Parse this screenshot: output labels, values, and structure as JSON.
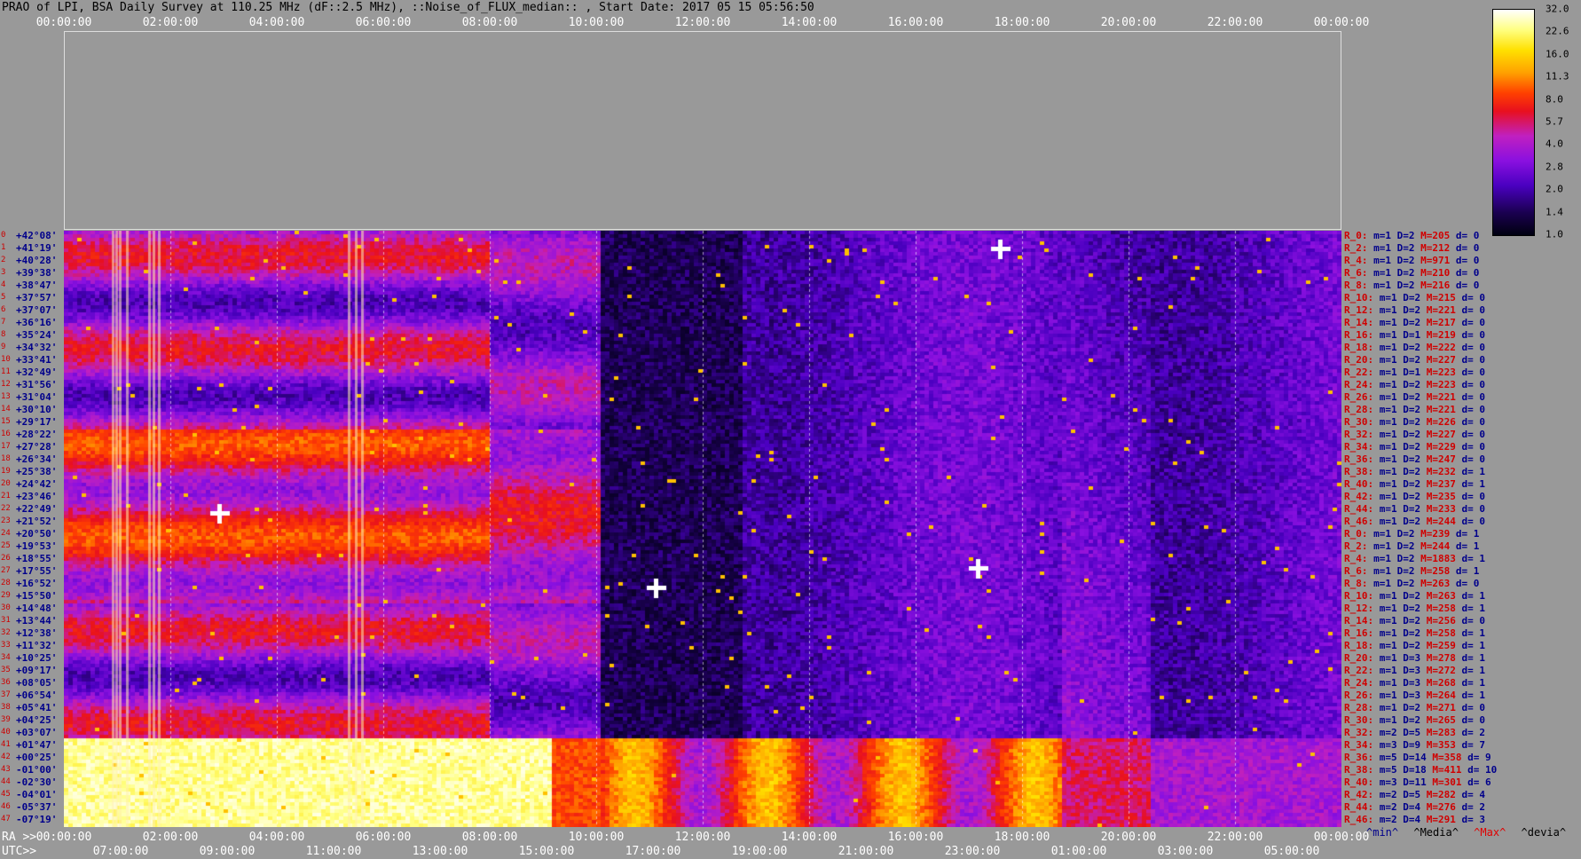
{
  "header": {
    "title": "PRAO of LPI, BSA Daily Survey at 110.25 MHz (dF::2.5 MHz), ::Noise_of_FLUX_median:: , Start Date: 2017 05 15 05:56:50"
  },
  "axes": {
    "top_ticks": [
      "00:00:00",
      "02:00:00",
      "04:00:00",
      "06:00:00",
      "08:00:00",
      "10:00:00",
      "12:00:00",
      "14:00:00",
      "16:00:00",
      "18:00:00",
      "20:00:00",
      "22:00:00",
      "00:00:00"
    ],
    "ra_label": "RA >>",
    "ra_ticks": [
      "00:00:00",
      "02:00:00",
      "04:00:00",
      "06:00:00",
      "08:00:00",
      "10:00:00",
      "12:00:00",
      "14:00:00",
      "16:00:00",
      "18:00:00",
      "20:00:00",
      "22:00:00",
      "00:00:00"
    ],
    "utc_label": "UTC>>",
    "utc_ticks": [
      "07:00:00",
      "09:00:00",
      "11:00:00",
      "13:00:00",
      "15:00:00",
      "17:00:00",
      "19:00:00",
      "21:00:00",
      "23:00:00",
      "01:00:00",
      "03:00:00",
      "05:00:00"
    ]
  },
  "declinations": [
    "+42°08'",
    "+41°19'",
    "+40°28'",
    "+39°38'",
    "+38°47'",
    "+37°57'",
    "+37°07'",
    "+36°16'",
    "+35°24'",
    "+34°32'",
    "+33°41'",
    "+32°49'",
    "+31°56'",
    "+31°04'",
    "+30°10'",
    "+29°17'",
    "+28°22'",
    "+27°28'",
    "+26°34'",
    "+25°38'",
    "+24°42'",
    "+23°46'",
    "+22°49'",
    "+21°52'",
    "+20°50'",
    "+19°53'",
    "+18°55'",
    "+17°55'",
    "+16°52'",
    "+15°50'",
    "+14°48'",
    "+13°44'",
    "+12°38'",
    "+11°32'",
    "+10°25'",
    "+09°17'",
    "+08°05'",
    "+06°54'",
    "+05°41'",
    "+04°25'",
    "+03°07'",
    "+01°47'",
    "+00°25'",
    "-01°00'",
    "-02°30'",
    "-04°01'",
    "-05°37'",
    "-07°19'"
  ],
  "stats": [
    {
      "r": "R_0:",
      "min": "m=1",
      "dev": "D=2",
      "max": "M=205",
      "d": "d= 0"
    },
    {
      "r": "R_2:",
      "min": "m=1",
      "dev": "D=2",
      "max": "M=212",
      "d": "d= 0"
    },
    {
      "r": "R_4:",
      "min": "m=1",
      "dev": "D=2",
      "max": "M=971",
      "d": "d= 0"
    },
    {
      "r": "R_6:",
      "min": "m=1",
      "dev": "D=2",
      "max": "M=210",
      "d": "d= 0"
    },
    {
      "r": "R_8:",
      "min": "m=1",
      "dev": "D=2",
      "max": "M=216",
      "d": "d= 0"
    },
    {
      "r": "R_10:",
      "min": "m=1",
      "dev": "D=2",
      "max": "M=215",
      "d": "d= 0"
    },
    {
      "r": "R_12:",
      "min": "m=1",
      "dev": "D=2",
      "max": "M=221",
      "d": "d= 0"
    },
    {
      "r": "R_14:",
      "min": "m=1",
      "dev": "D=2",
      "max": "M=217",
      "d": "d= 0"
    },
    {
      "r": "R_16:",
      "min": "m=1",
      "dev": "D=1",
      "max": "M=219",
      "d": "d= 0"
    },
    {
      "r": "R_18:",
      "min": "m=1",
      "dev": "D=2",
      "max": "M=222",
      "d": "d= 0"
    },
    {
      "r": "R_20:",
      "min": "m=1",
      "dev": "D=2",
      "max": "M=227",
      "d": "d= 0"
    },
    {
      "r": "R_22:",
      "min": "m=1",
      "dev": "D=1",
      "max": "M=223",
      "d": "d= 0"
    },
    {
      "r": "R_24:",
      "min": "m=1",
      "dev": "D=2",
      "max": "M=223",
      "d": "d= 0"
    },
    {
      "r": "R_26:",
      "min": "m=1",
      "dev": "D=2",
      "max": "M=221",
      "d": "d= 0"
    },
    {
      "r": "R_28:",
      "min": "m=1",
      "dev": "D=2",
      "max": "M=221",
      "d": "d= 0"
    },
    {
      "r": "R_30:",
      "min": "m=1",
      "dev": "D=2",
      "max": "M=226",
      "d": "d= 0"
    },
    {
      "r": "R_32:",
      "min": "m=1",
      "dev": "D=2",
      "max": "M=227",
      "d": "d= 0"
    },
    {
      "r": "R_34:",
      "min": "m=1",
      "dev": "D=2",
      "max": "M=229",
      "d": "d= 0"
    },
    {
      "r": "R_36:",
      "min": "m=1",
      "dev": "D=2",
      "max": "M=247",
      "d": "d= 0"
    },
    {
      "r": "R_38:",
      "min": "m=1",
      "dev": "D=2",
      "max": "M=232",
      "d": "d= 1"
    },
    {
      "r": "R_40:",
      "min": "m=1",
      "dev": "D=2",
      "max": "M=237",
      "d": "d= 1"
    },
    {
      "r": "R_42:",
      "min": "m=1",
      "dev": "D=2",
      "max": "M=235",
      "d": "d= 0"
    },
    {
      "r": "R_44:",
      "min": "m=1",
      "dev": "D=2",
      "max": "M=233",
      "d": "d= 0"
    },
    {
      "r": "R_46:",
      "min": "m=1",
      "dev": "D=2",
      "max": "M=244",
      "d": "d= 0"
    },
    {
      "r": "R_0:",
      "min": "m=1",
      "dev": "D=2",
      "max": "M=239",
      "d": "d= 1"
    },
    {
      "r": "R_2:",
      "min": "m=1",
      "dev": "D=2",
      "max": "M=244",
      "d": "d= 1"
    },
    {
      "r": "R_4:",
      "min": "m=1",
      "dev": "D=2",
      "max": "M=1883",
      "d": "d= 1"
    },
    {
      "r": "R_6:",
      "min": "m=1",
      "dev": "D=2",
      "max": "M=258",
      "d": "d= 1"
    },
    {
      "r": "R_8:",
      "min": "m=1",
      "dev": "D=2",
      "max": "M=263",
      "d": "d= 0"
    },
    {
      "r": "R_10:",
      "min": "m=1",
      "dev": "D=2",
      "max": "M=263",
      "d": "d= 1"
    },
    {
      "r": "R_12:",
      "min": "m=1",
      "dev": "D=2",
      "max": "M=258",
      "d": "d= 1"
    },
    {
      "r": "R_14:",
      "min": "m=1",
      "dev": "D=2",
      "max": "M=256",
      "d": "d= 0"
    },
    {
      "r": "R_16:",
      "min": "m=1",
      "dev": "D=2",
      "max": "M=258",
      "d": "d= 1"
    },
    {
      "r": "R_18:",
      "min": "m=1",
      "dev": "D=2",
      "max": "M=259",
      "d": "d= 1"
    },
    {
      "r": "R_20:",
      "min": "m=1",
      "dev": "D=3",
      "max": "M=278",
      "d": "d= 1"
    },
    {
      "r": "R_22:",
      "min": "m=1",
      "dev": "D=3",
      "max": "M=272",
      "d": "d= 1"
    },
    {
      "r": "R_24:",
      "min": "m=1",
      "dev": "D=3",
      "max": "M=268",
      "d": "d= 1"
    },
    {
      "r": "R_26:",
      "min": "m=1",
      "dev": "D=3",
      "max": "M=264",
      "d": "d= 1"
    },
    {
      "r": "R_28:",
      "min": "m=1",
      "dev": "D=2",
      "max": "M=271",
      "d": "d= 0"
    },
    {
      "r": "R_30:",
      "min": "m=1",
      "dev": "D=2",
      "max": "M=265",
      "d": "d= 0"
    },
    {
      "r": "R_32:",
      "min": "m=2",
      "dev": "D=5",
      "max": "M=283",
      "d": "d= 2"
    },
    {
      "r": "R_34:",
      "min": "m=3",
      "dev": "D=9",
      "max": "M=353",
      "d": "d= 7"
    },
    {
      "r": "R_36:",
      "min": "m=5",
      "dev": "D=14",
      "max": "M=358",
      "d": "d= 9"
    },
    {
      "r": "R_38:",
      "min": "m=5",
      "dev": "D=18",
      "max": "M=411",
      "d": "d= 10"
    },
    {
      "r": "R_40:",
      "min": "m=3",
      "dev": "D=11",
      "max": "M=301",
      "d": "d= 6"
    },
    {
      "r": "R_42:",
      "min": "m=2",
      "dev": "D=5",
      "max": "M=282",
      "d": "d= 4"
    },
    {
      "r": "R_44:",
      "min": "m=2",
      "dev": "D=4",
      "max": "M=276",
      "d": "d= 2"
    },
    {
      "r": "R_46:",
      "min": "m=2",
      "dev": "D=4",
      "max": "M=291",
      "d": "d= 3"
    }
  ],
  "legend": {
    "min": "^min^",
    "median": "^Media^",
    "max": "^Max^",
    "dev": "^devia^"
  },
  "colorbar": {
    "labels": [
      "32.0",
      "22.6",
      "16.0",
      "11.3",
      "8.0",
      "5.7",
      "4.0",
      "2.8",
      "2.0",
      "1.4",
      "1.0"
    ],
    "colors": [
      "#000010",
      "#1a0050",
      "#4a00c0",
      "#8a10e0",
      "#c020c0",
      "#e8101e",
      "#ff4000",
      "#ffa000",
      "#ffe000",
      "#ffff80",
      "#ffffff"
    ]
  },
  "colors": {
    "ra_text": "#ffffff",
    "dec_text": "#00008b",
    "stat_red": "#d00000",
    "stat_navy": "#00008b",
    "background": "#999999"
  }
}
